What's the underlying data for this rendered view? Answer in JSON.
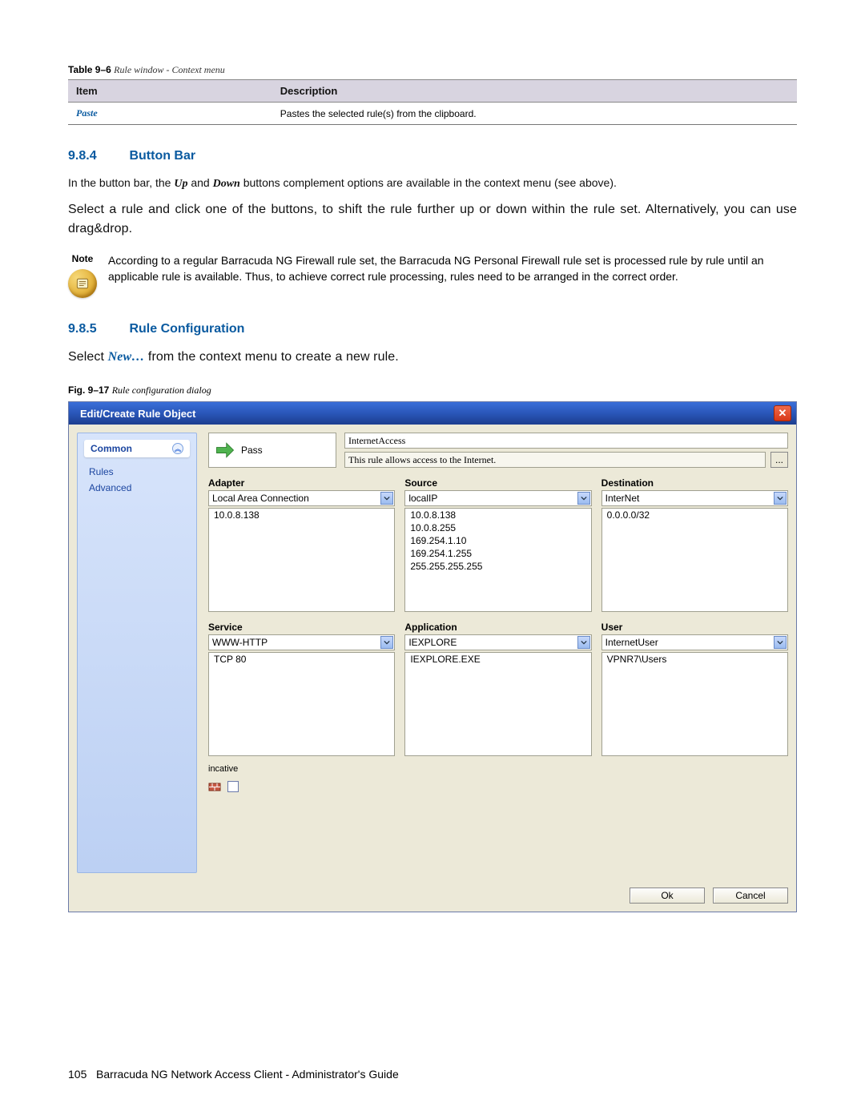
{
  "table": {
    "caption_label": "Table 9–6",
    "caption_title": "Rule window - Context menu",
    "headers": [
      "Item",
      "Description"
    ],
    "rows": [
      {
        "item": "Paste",
        "desc": "Pastes the selected rule(s) from the clipboard."
      }
    ]
  },
  "sec984": {
    "num": "9.8.4",
    "title": "Button Bar",
    "p1_a": "In the button bar, the ",
    "p1_up": "Up",
    "p1_b": " and ",
    "p1_down": "Down",
    "p1_c": " buttons complement options are available in the context menu (see above).",
    "p2": "Select a rule and click one of the buttons, to shift the rule further up or down within the rule set. Alternatively, you can use drag&drop.",
    "note_label": "Note",
    "note": "According to a regular Barracuda NG Firewall rule set, the Barracuda NG Personal Firewall rule set is processed rule by rule until an applicable rule is available. Thus, to achieve correct rule processing, rules need to be arranged in the correct order."
  },
  "sec985": {
    "num": "9.8.5",
    "title": "Rule Configuration",
    "p1_a": "Select ",
    "p1_new": "New…",
    "p1_b": " from the context menu to create a new rule."
  },
  "fig": {
    "caption_label": "Fig. 9–17",
    "caption_title": "Rule configuration dialog"
  },
  "dialog": {
    "title": "Edit/Create Rule Object",
    "side_header": "Common",
    "side_links": [
      "Rules",
      "Advanced"
    ],
    "action_label": "Pass",
    "rule_name": "InternetAccess",
    "rule_desc": "This rule allows access to the Internet.",
    "ell": "...",
    "cols": {
      "adapter": {
        "label": "Adapter",
        "value": "Local Area Connection",
        "items": [
          "10.0.8.138"
        ]
      },
      "source": {
        "label": "Source",
        "value": "localIP",
        "items": [
          "10.0.8.138",
          "10.0.8.255",
          "169.254.1.10",
          "169.254.1.255",
          "255.255.255.255"
        ]
      },
      "dest": {
        "label": "Destination",
        "value": "InterNet",
        "items": [
          "0.0.0.0/32"
        ]
      },
      "service": {
        "label": "Service",
        "value": "WWW-HTTP",
        "items": [
          "TCP  80"
        ]
      },
      "app": {
        "label": "Application",
        "value": "IEXPLORE",
        "items": [
          "IEXPLORE.EXE"
        ]
      },
      "user": {
        "label": "User",
        "value": "InternetUser",
        "items": [
          "VPNR7\\Users"
        ]
      }
    },
    "inactive_label": "incative",
    "ok": "Ok",
    "cancel": "Cancel"
  },
  "footer": {
    "pg": "105",
    "txt": "Barracuda NG Network Access Client - Administrator's Guide"
  }
}
